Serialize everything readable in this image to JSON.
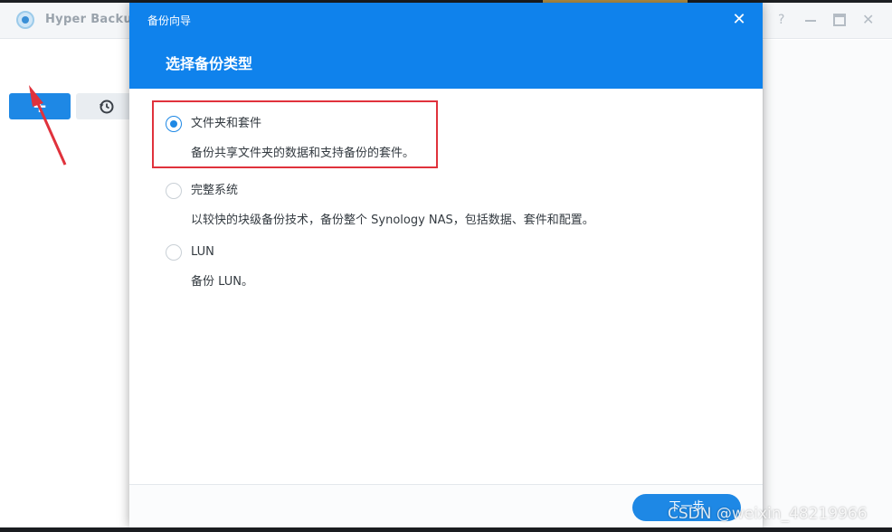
{
  "app": {
    "title": "Hyper Backup",
    "help_label": "?",
    "close_label": "✕"
  },
  "sidebar": {
    "add_label": "+"
  },
  "wizard": {
    "title": "备份向导",
    "close_label": "✕",
    "step_title": "选择备份类型",
    "options": [
      {
        "label": "文件夹和套件",
        "description": "备份共享文件夹的数据和支持备份的套件。",
        "selected": true
      },
      {
        "label": "完整系统",
        "description": "以较快的块级备份技术，备份整个 Synology NAS，包括数据、套件和配置。",
        "selected": false
      },
      {
        "label": "LUN",
        "description": "备份 LUN。",
        "selected": false
      }
    ],
    "next_label": "下一步"
  },
  "watermark": "CSDN @weixin_48219966",
  "colors": {
    "primary": "#1e88e5",
    "header_blue": "#0f82ec",
    "annotation_red": "#e0323c"
  }
}
